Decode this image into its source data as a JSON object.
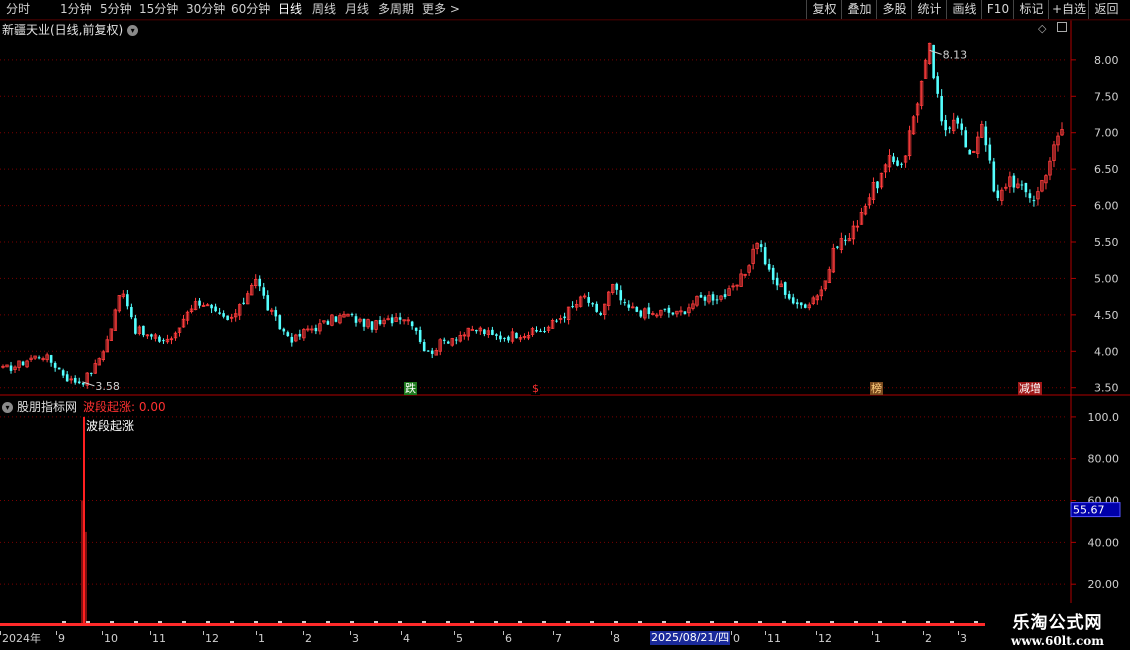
{
  "toolbar": {
    "periods": [
      "分时",
      "1分钟",
      "5分钟",
      "15分钟",
      "30分钟",
      "60分钟",
      "日线",
      "周线",
      "月线",
      "多周期",
      "更多"
    ],
    "active_period": "日线",
    "more_arrow": ">",
    "right_buttons": [
      "复权",
      "叠加",
      "多股",
      "统计",
      "画线",
      "F10",
      "标记",
      "+自选",
      "返回"
    ]
  },
  "main_chart": {
    "title": "新疆天业(日线,前复权)",
    "icons": [
      "chevron-down-icon",
      "diamond-icon",
      "panel-toggle-icon"
    ],
    "high_label": "8.13",
    "low_label": "3.58",
    "y_ticks": [
      "8.00",
      "7.50",
      "7.00",
      "6.50",
      "6.00",
      "5.50",
      "5.00",
      "4.50",
      "4.00",
      "3.50"
    ],
    "signals": [
      {
        "label": "跌",
        "bg": "#1e7a1e",
        "color": "#ffffff"
      },
      {
        "label": "$",
        "bg": "#000000",
        "color": "#ff3030"
      },
      {
        "label": "榜",
        "bg": "#7a4a1e",
        "color": "#ffd080"
      },
      {
        "label": "减增",
        "bg": "#a01818",
        "color": "#ffffff"
      }
    ],
    "colors": {
      "up": "#ff3c3c",
      "down": "#54ffff",
      "grid": "#7a0000",
      "axis": "#b00000"
    }
  },
  "indicator": {
    "source": "股朋指标网",
    "series_name": "波段起涨",
    "value": "0.00",
    "marker_label": "波段起涨",
    "y_ticks": [
      "100.0",
      "80.00",
      "60.00",
      "40.00",
      "20.00"
    ],
    "current_value": "55.67"
  },
  "chart_data": [
    {
      "type": "candlestick",
      "title": "新疆天业(日线,前复权)",
      "ylim": [
        3.4,
        8.3
      ],
      "x_ticks": [
        "2024年",
        "9",
        "10",
        "11",
        "12",
        "1",
        "2",
        "3",
        "4",
        "5",
        "6",
        "7",
        "8",
        "2025/08/21/四",
        "0",
        "11",
        "12",
        "1",
        "2",
        "3"
      ],
      "close_trend": [
        3.75,
        3.8,
        3.9,
        3.95,
        3.8,
        3.6,
        3.58,
        3.8,
        4.2,
        4.9,
        4.3,
        4.2,
        4.15,
        4.2,
        4.6,
        4.7,
        4.5,
        4.4,
        4.6,
        5.05,
        4.6,
        4.3,
        4.15,
        4.3,
        4.35,
        4.45,
        4.5,
        4.4,
        4.35,
        4.4,
        4.5,
        4.4,
        3.95,
        4.1,
        4.2,
        4.25,
        4.3,
        4.2,
        4.2,
        4.25,
        4.25,
        4.3,
        4.45,
        4.6,
        4.75,
        4.45,
        4.9,
        4.6,
        4.55,
        4.5,
        4.55,
        4.5,
        4.65,
        4.75,
        4.75,
        4.8,
        5.05,
        5.55,
        5.0,
        4.85,
        4.6,
        4.7,
        4.9,
        5.5,
        5.55,
        6.0,
        6.3,
        6.6,
        6.6,
        7.4,
        8.13,
        7.0,
        7.3,
        6.6,
        7.2,
        6.0,
        6.4,
        6.2,
        6.1,
        6.6,
        7.05
      ],
      "high": 8.13,
      "low": 3.58
    },
    {
      "type": "bar",
      "title": "波段起涨",
      "ylim": [
        0,
        110
      ],
      "values_note_index": [
        9
      ],
      "series": [
        {
          "name": "波段起涨",
          "peak": 100,
          "current": 0.0
        }
      ]
    }
  ]
}
